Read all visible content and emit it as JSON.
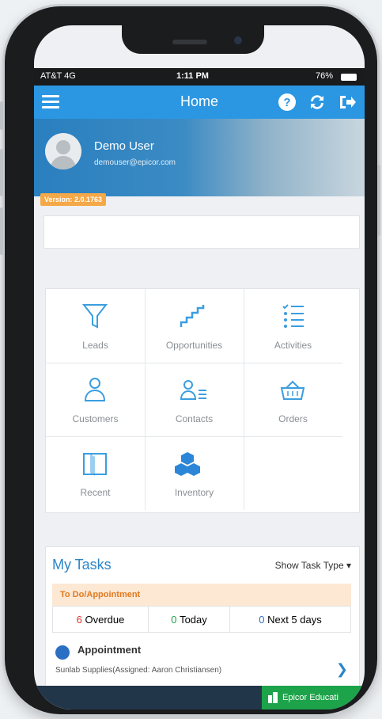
{
  "status": {
    "carrier": "AT&T 4G",
    "time": "1:11 PM",
    "battery": "76%"
  },
  "appbar": {
    "title": "Home",
    "menu_icon": "hamburger-icon",
    "help_icon": "help-icon",
    "sync_icon": "sync-icon",
    "logout_icon": "logout-icon"
  },
  "profile": {
    "name": "Demo User",
    "email": "demouser@epicor.com"
  },
  "version": "Version: 2.0.1763",
  "tiles": [
    {
      "label": "Leads",
      "icon": "funnel-icon"
    },
    {
      "label": "Opportunities",
      "icon": "stairs-icon"
    },
    {
      "label": "Activities",
      "icon": "checklist-icon"
    },
    {
      "label": "Customers",
      "icon": "person-icon"
    },
    {
      "label": "Contacts",
      "icon": "contact-list-icon"
    },
    {
      "label": "Orders",
      "icon": "basket-icon"
    },
    {
      "label": "Recent",
      "icon": "book-icon"
    },
    {
      "label": "Inventory",
      "icon": "boxes-icon"
    }
  ],
  "tasks": {
    "title": "My Tasks",
    "show_type": "Show Task Type",
    "category": "To Do/Appointment",
    "overdue_count": "6",
    "overdue_label": "Overdue",
    "today_count": "0",
    "today_label": "Today",
    "next_count": "0",
    "next_label": "Next 5 days",
    "item_title": "Appointment",
    "item_desc": "Sunlab Supplies(Assigned: Aaron Christiansen)"
  },
  "badge": "Epicor Educati",
  "colors": {
    "primary": "#2b97e3",
    "orange": "#f4a847",
    "green": "#1da34a",
    "red": "#e0312b"
  }
}
